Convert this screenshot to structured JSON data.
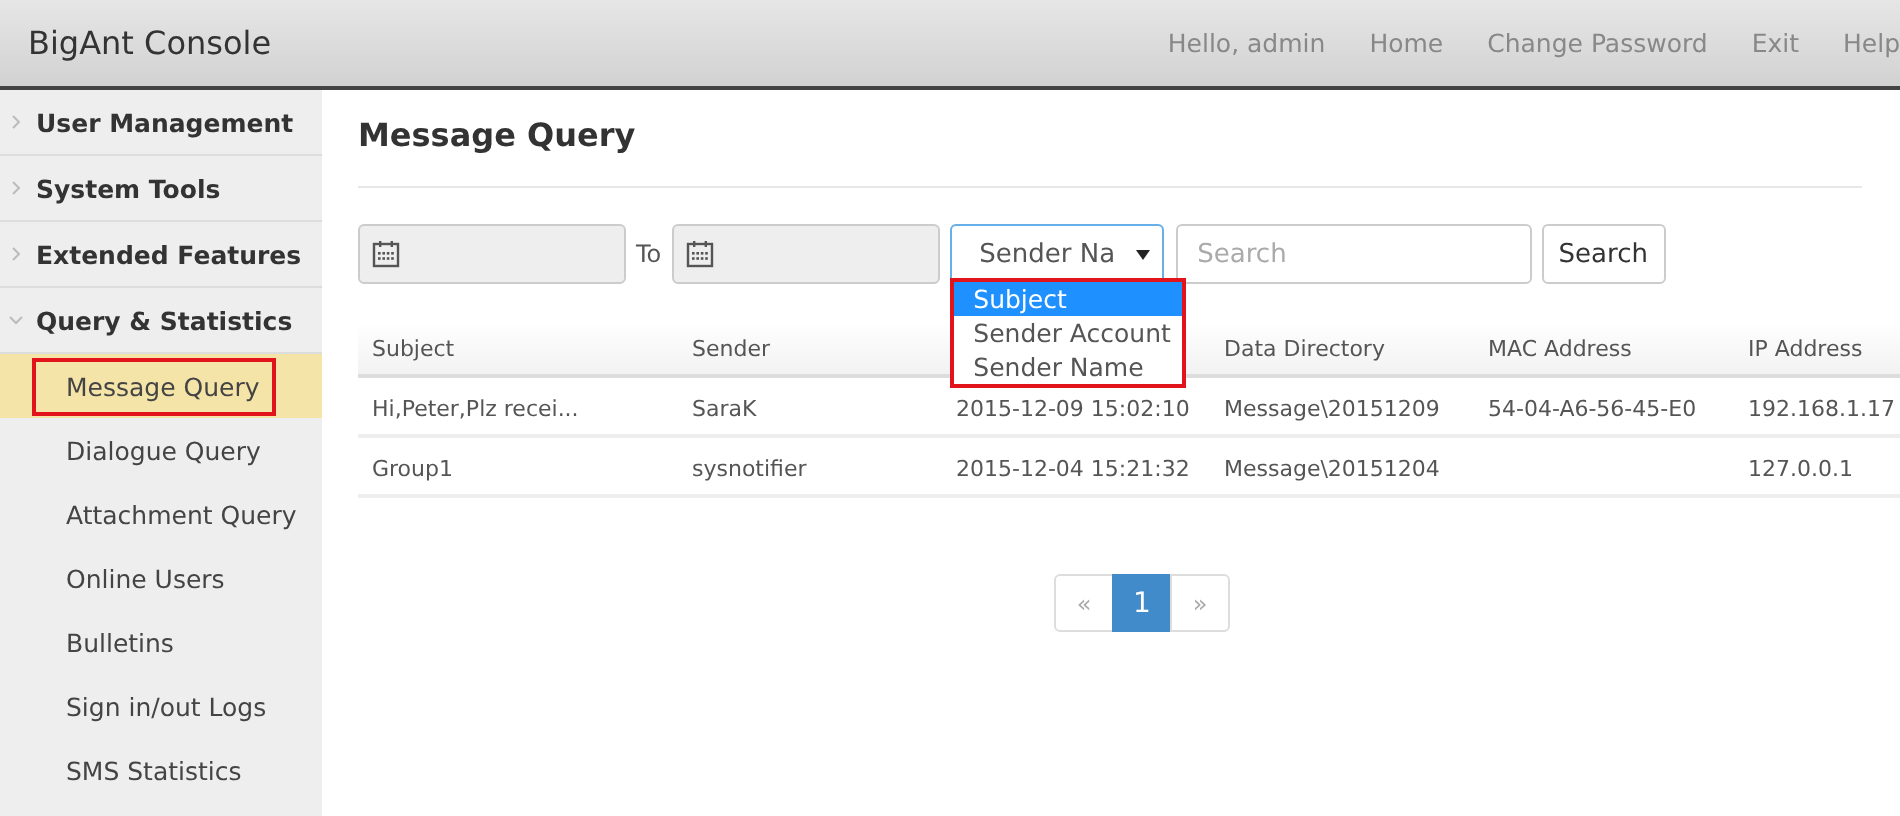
{
  "header": {
    "title": "BigAnt Console",
    "links": [
      "Hello, admin",
      "Home",
      "Change Password",
      "Exit",
      "Help"
    ]
  },
  "sidebar": {
    "groups": [
      {
        "label": "User Management",
        "expanded": false
      },
      {
        "label": "System Tools",
        "expanded": false
      },
      {
        "label": "Extended Features",
        "expanded": false
      },
      {
        "label": "Query & Statistics",
        "expanded": true,
        "children": [
          {
            "label": "Message Query",
            "selected": true,
            "highlighted": true
          },
          {
            "label": "Dialogue Query",
            "selected": false,
            "highlighted": false
          },
          {
            "label": "Attachment Query",
            "selected": false,
            "highlighted": false
          },
          {
            "label": "Online Users",
            "selected": false,
            "highlighted": false
          },
          {
            "label": "Bulletins",
            "selected": false,
            "highlighted": false
          },
          {
            "label": "Sign in/out Logs",
            "selected": false,
            "highlighted": false
          },
          {
            "label": "SMS Statistics",
            "selected": false,
            "highlighted": false
          }
        ]
      }
    ]
  },
  "page_title": "Message Query",
  "filters": {
    "to_label": "To",
    "field_select": {
      "value": "Sender Na",
      "expanded": true,
      "highlighted": true,
      "options": [
        {
          "label": "Subject",
          "selected": true
        },
        {
          "label": "Sender Account",
          "selected": false
        },
        {
          "label": "Sender Name",
          "selected": false
        }
      ]
    },
    "search": {
      "placeholder": "Search"
    },
    "search_button": "Search"
  },
  "table": {
    "columns": [
      {
        "label": "Subject"
      },
      {
        "label": "Sender"
      },
      {},
      {
        "label": "Data Directory"
      },
      {
        "label": "MAC Address"
      },
      {
        "label": "IP Address"
      }
    ],
    "rows": [
      [
        "Hi,Peter,Plz recei...",
        "SaraK",
        "2015-12-09 15:02:10",
        "Message\\20151209",
        "54-04-A6-56-45-E0",
        "192.168.1.17"
      ],
      [
        "Group1",
        "sysnotifier",
        "2015-12-04 15:21:32",
        "Message\\20151204",
        "",
        "127.0.0.1"
      ]
    ]
  },
  "pagination": {
    "prev": "«",
    "pages": [
      {
        "label": "1",
        "selected": true
      }
    ],
    "next": "»"
  }
}
